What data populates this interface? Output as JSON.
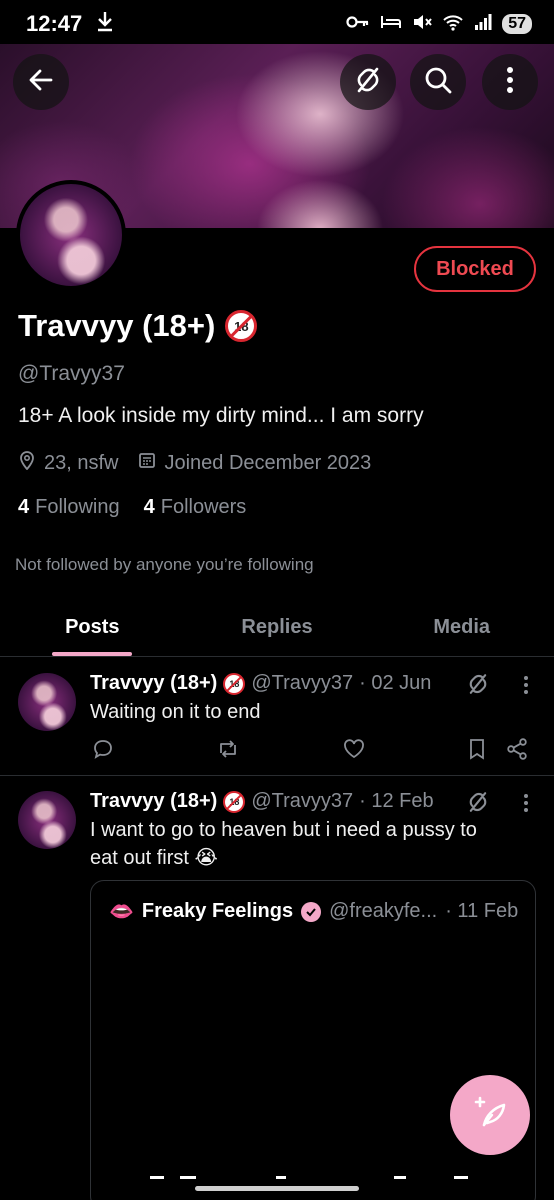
{
  "status_bar": {
    "time": "12:47",
    "battery": "57"
  },
  "header": {
    "back_icon": "arrow-left-icon",
    "broken_link_icon": "broken-link-icon",
    "search_icon": "search-icon",
    "more_icon": "more-vertical-icon"
  },
  "profile": {
    "blocked_label": "Blocked",
    "display_name": "Travvyy (18+)",
    "adult_badge": "18",
    "handle": "@Travyy37",
    "bio": "18+ A look inside my dirty mind... I am sorry",
    "location": "23, nsfw",
    "joined": "Joined December 2023",
    "following_count": "4",
    "following_label": "Following",
    "followers_count": "4",
    "followers_label": "Followers",
    "not_followed": "Not followed by anyone you’re following"
  },
  "tabs": [
    {
      "label": "Posts",
      "active": true
    },
    {
      "label": "Replies",
      "active": false
    },
    {
      "label": "Media",
      "active": false
    }
  ],
  "posts": [
    {
      "name": "Travvyy (18+)",
      "badge": "18",
      "handle": "@Travyy37",
      "date": "· 02 Jun",
      "text": "Waiting on it to end"
    },
    {
      "name": "Travvyy (18+)",
      "badge": "18",
      "handle": "@Travyy37",
      "date": "· 12 Feb",
      "text": "I want to go to heaven but i need a pussy to eat out first 😭",
      "quote": {
        "emoji": "👄",
        "name": "Freaky Feelings",
        "handle": "@freakyfe...",
        "date": "· 11 Feb"
      }
    }
  ],
  "colors": {
    "accent": "#f4a8c8",
    "blocked": "#e5343f",
    "muted": "#8b8f96"
  }
}
